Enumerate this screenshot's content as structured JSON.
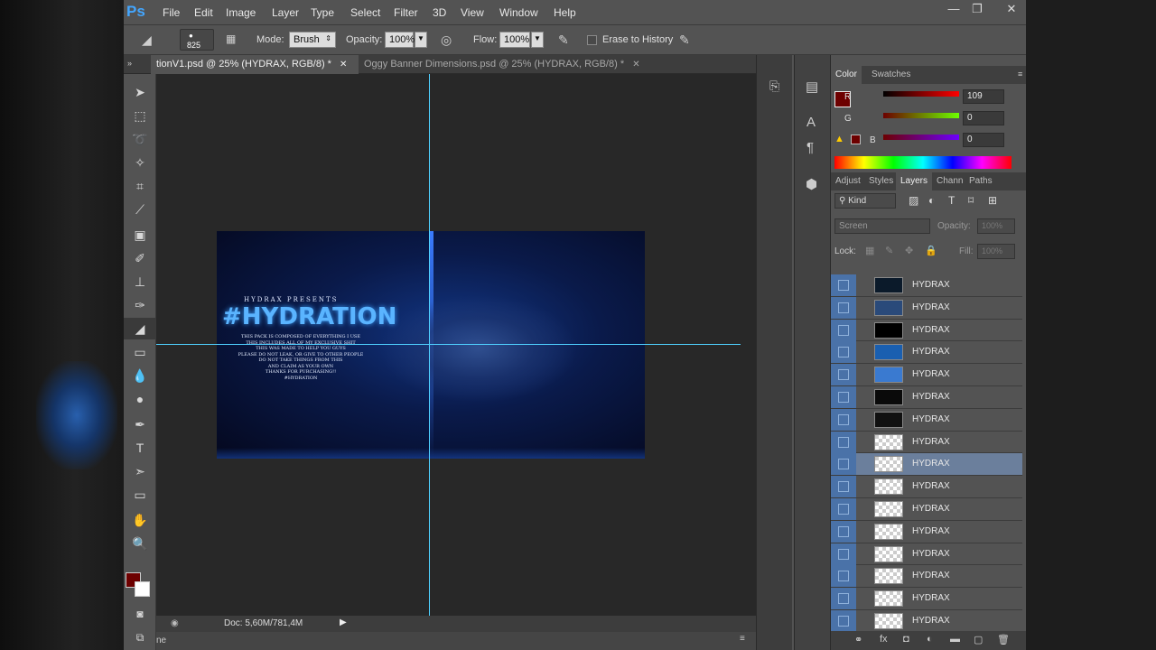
{
  "app": {
    "logo": "Ps"
  },
  "menus": [
    "File",
    "Edit",
    "Image",
    "Layer",
    "Type",
    "Select",
    "Filter",
    "3D",
    "View",
    "Window",
    "Help"
  ],
  "window_controls": {
    "minimize": "—",
    "restore": "❐",
    "close": "✕"
  },
  "options": {
    "brush_size": "825",
    "mode_label": "Mode:",
    "mode_value": "Brush",
    "opacity_label": "Opacity:",
    "opacity_value": "100%",
    "flow_label": "Flow:",
    "flow_value": "100%",
    "erase_history_label": "Erase to History"
  },
  "tabs": [
    {
      "label": "tionV1.psd @ 25% (HYDRAX, RGB/8) *",
      "active": true
    },
    {
      "label": "Oggy Banner Dimensions.psd @ 25% (HYDRAX, RGB/8) *",
      "active": false
    }
  ],
  "artwork": {
    "presents": "HYDRAX PRESENTS",
    "title": "#HYDRATION",
    "lines": [
      "THIS PACK IS COMPOSED OF EVERYTHING I USE",
      "THIS INCLUDES ALL OF MY EXCLUSIVE SHIT",
      "THIS WAS MADE TO HELP YOU GUYS",
      "PLEASE DO NOT LEAK, OR GIVE TO OTHER PEOPLE",
      "DO NOT TAKE THINGS FROM THIS",
      "AND CLAIM AS YOUR OWN",
      "THANKS FOR PURCHASING!!",
      "#HYDRATION"
    ]
  },
  "status": {
    "doc": "Doc: 5,60M/781,4M",
    "bottom_text": "ne"
  },
  "color_panel": {
    "tabs": [
      "Color",
      "Swatches"
    ],
    "r_label": "R",
    "g_label": "G",
    "b_label": "B",
    "r_value": "109",
    "g_value": "0",
    "b_value": "0",
    "fg_color": "#6d0000"
  },
  "layers_panel": {
    "tabs": [
      "Adjust",
      "Styles",
      "Layers",
      "Chann",
      "Paths"
    ],
    "filter_kind": "Kind",
    "blend_mode": "Screen",
    "opacity_label": "Opacity:",
    "opacity_value": "100%",
    "lock_label": "Lock:",
    "fill_label": "Fill:",
    "fill_value": "100%",
    "layers": [
      "HYDRAX",
      "HYDRAX",
      "HYDRAX",
      "HYDRAX",
      "HYDRAX",
      "HYDRAX",
      "HYDRAX",
      "HYDRAX",
      "HYDRAX",
      "HYDRAX",
      "HYDRAX",
      "HYDRAX",
      "HYDRAX",
      "HYDRAX",
      "HYDRAX",
      "HYDRAX"
    ],
    "selected_index": 8
  }
}
